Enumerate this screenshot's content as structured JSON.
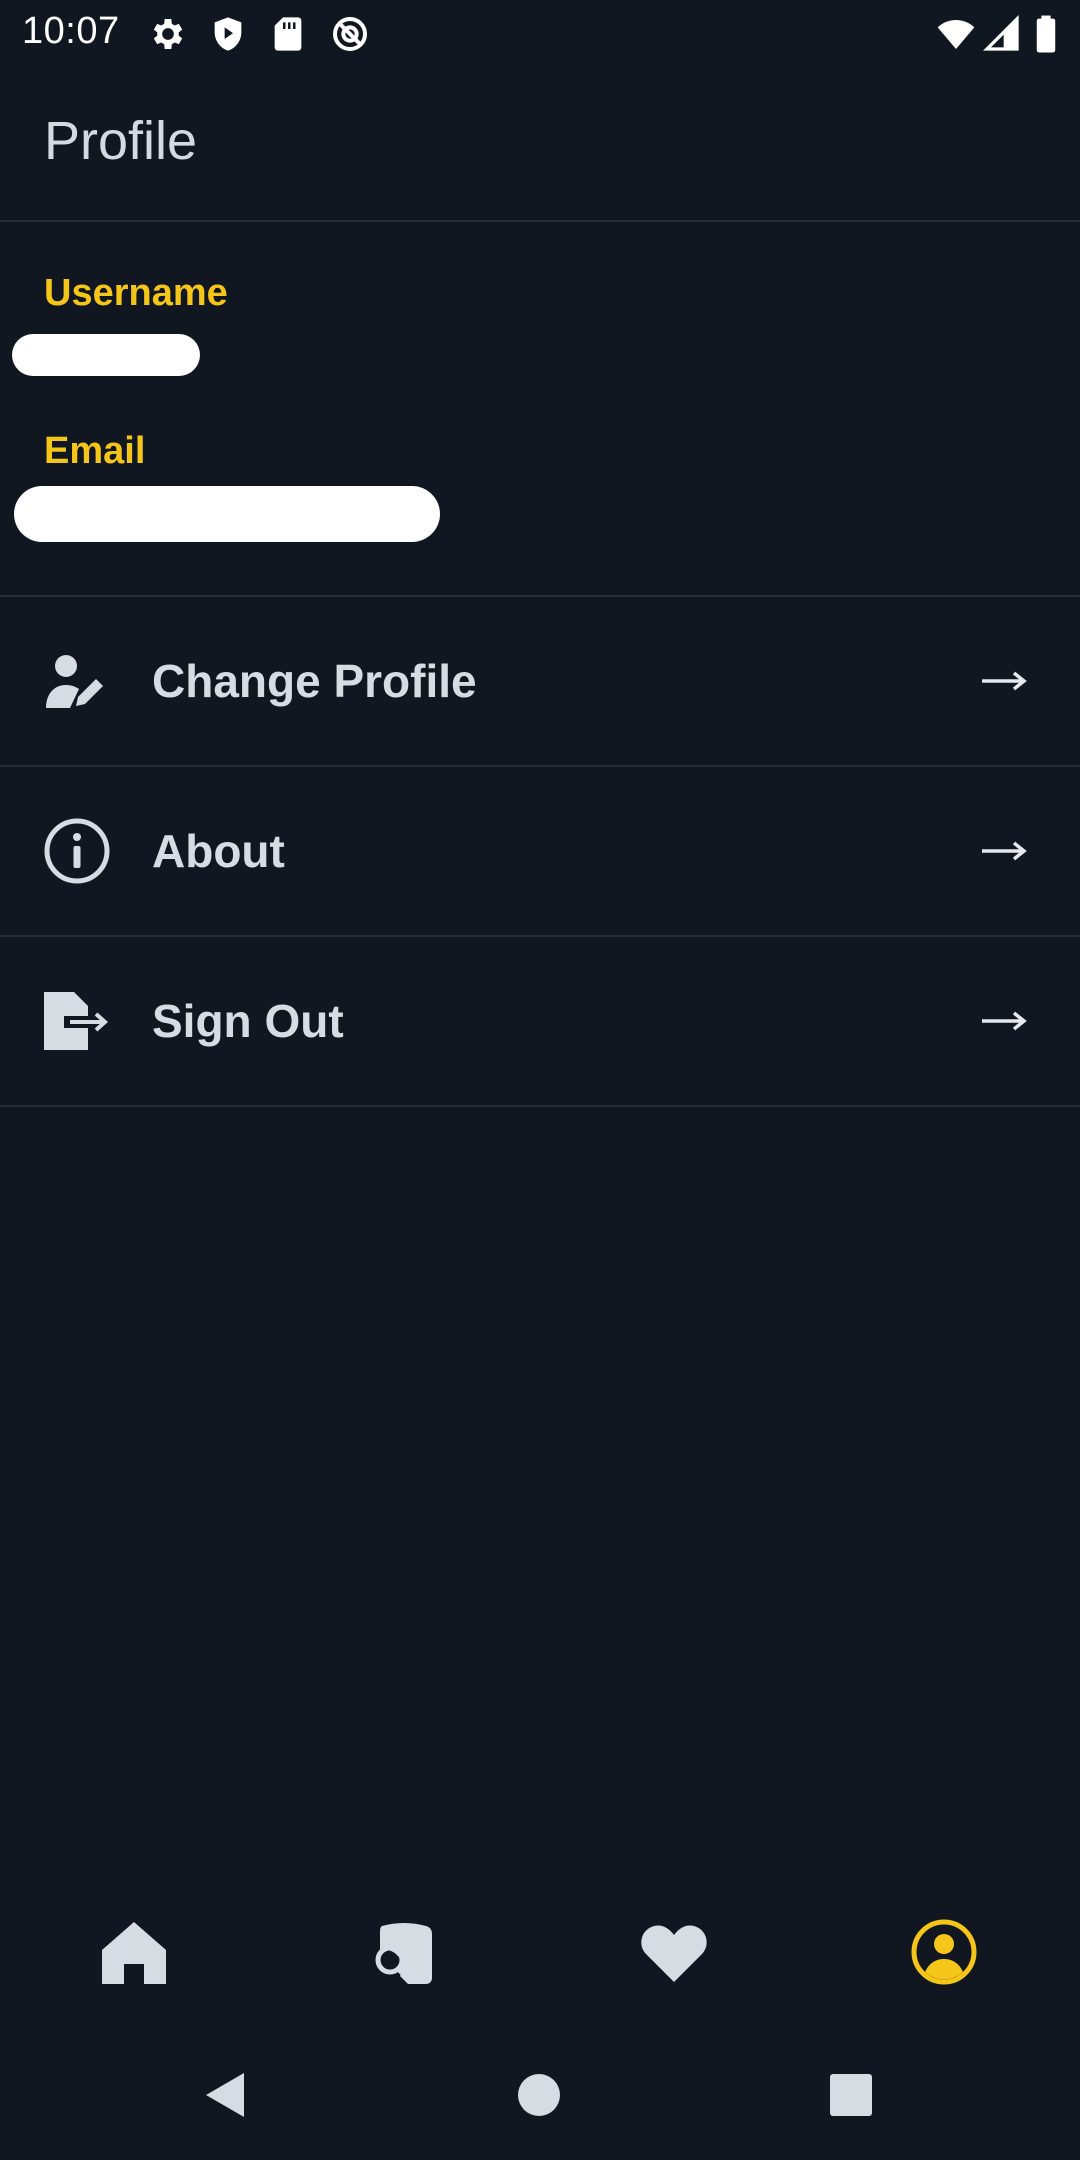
{
  "status_bar": {
    "time": "10:07",
    "left_icons": [
      "settings-icon",
      "shield-icon",
      "sd-card-icon",
      "no-location-icon"
    ],
    "right_icons": [
      "wifi-icon",
      "signal-icon",
      "battery-icon"
    ]
  },
  "header": {
    "title": "Profile"
  },
  "profile": {
    "username_label": "Username",
    "username_value": "",
    "email_label": "Email",
    "email_value": ""
  },
  "menu": {
    "items": [
      {
        "label": "Change Profile",
        "icon": "user-edit-icon"
      },
      {
        "label": "About",
        "icon": "info-icon"
      },
      {
        "label": "Sign Out",
        "icon": "sign-out-icon"
      }
    ]
  },
  "bottom_nav": {
    "items": [
      {
        "icon": "home-icon",
        "active": false
      },
      {
        "icon": "search-catalog-icon",
        "active": false
      },
      {
        "icon": "heart-icon",
        "active": false
      },
      {
        "icon": "profile-icon",
        "active": true
      }
    ]
  },
  "system_nav": [
    "back-icon",
    "home-circle-icon",
    "recents-icon"
  ],
  "colors": {
    "background": "#111720",
    "accent": "#f5c518",
    "text": "#d7dce3",
    "divider": "#262d37"
  }
}
